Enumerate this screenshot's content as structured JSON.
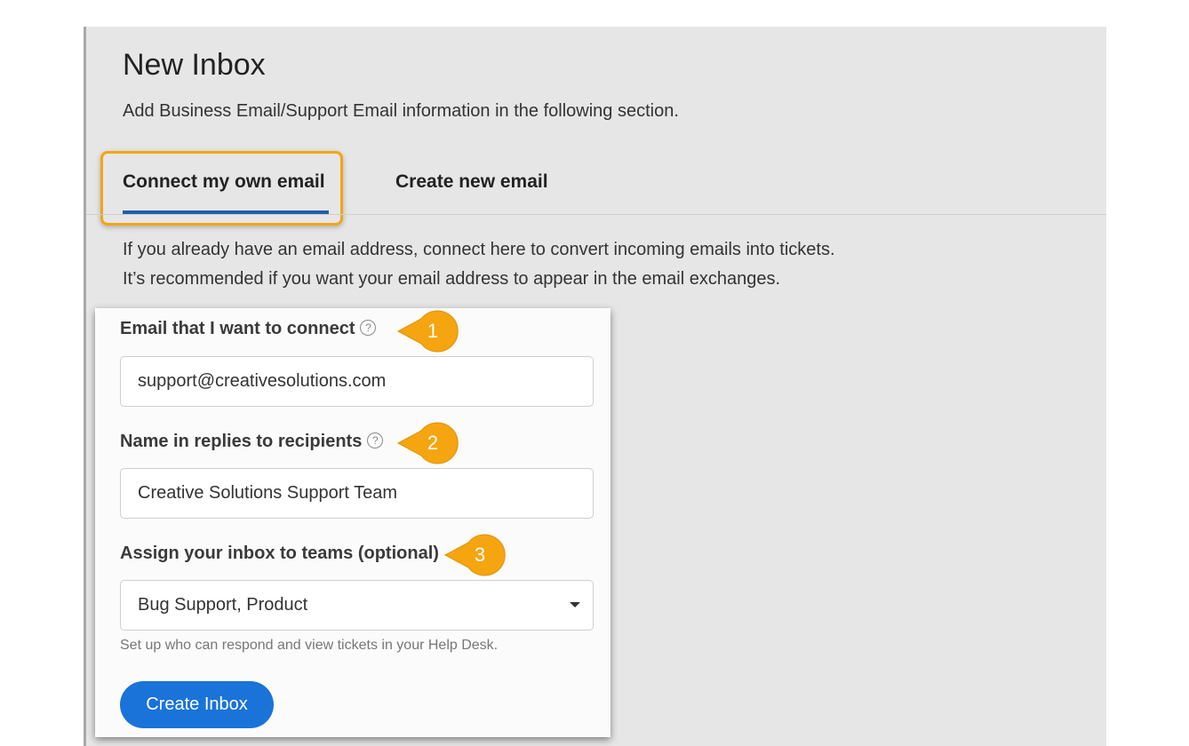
{
  "page": {
    "title": "New Inbox",
    "subtitle": "Add Business Email/Support Email information in the following section."
  },
  "tabs": [
    {
      "label": "Connect my own email",
      "active": true
    },
    {
      "label": "Create new email",
      "active": false
    }
  ],
  "description": [
    "If you already have an email address, connect here to convert incoming emails into tickets.",
    "It’s recommended if you want your email address to appear in the email exchanges."
  ],
  "form": {
    "email_label": "Email that I want to connect",
    "email_value": "support@creativesolutions.com",
    "name_label": "Name in replies to recipients",
    "name_value": "Creative Solutions Support Team",
    "teams_label": "Assign your inbox to teams (optional)",
    "teams_value": "Bug Support, Product",
    "teams_hint": "Set up who can respond and view tickets in your Help Desk.",
    "submit_label": "Create Inbox",
    "help_glyph": "?"
  },
  "callouts": [
    "1",
    "2",
    "3"
  ],
  "colors": {
    "accent": "#1a73d9",
    "tab_underline": "#1f5fa8",
    "highlight": "#f2a516",
    "panel_bg": "#e6e6e6"
  },
  "icons": [
    "help-circle-icon",
    "caret-down-icon"
  ]
}
